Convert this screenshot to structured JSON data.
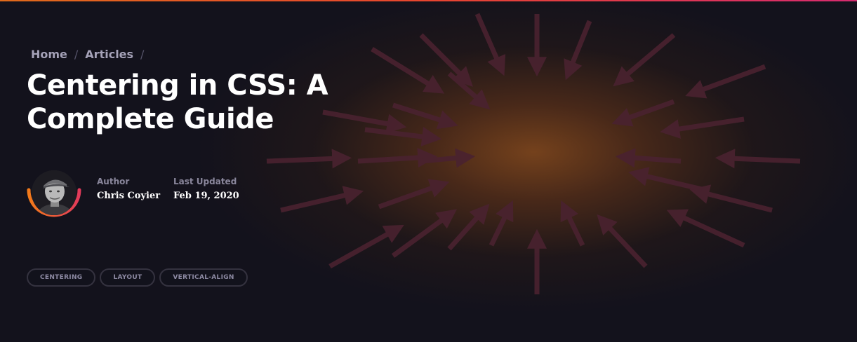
{
  "breadcrumb": {
    "items": [
      "Home",
      "Articles"
    ],
    "separator": "/"
  },
  "article": {
    "title": "Centering in CSS: A Complete Guide"
  },
  "meta": {
    "author_label": "Author",
    "author_name": "Chris Coyier",
    "updated_label": "Last Updated",
    "updated_date": "Feb 19, 2020"
  },
  "tags": [
    "CENTERING",
    "LAYOUT",
    "VERTICAL-ALIGN"
  ],
  "colors": {
    "background": "#13121c",
    "glow": "#7a441c",
    "arrow": "#4a2230",
    "accent_start": "#e06a1b",
    "accent_end": "#d62b6f"
  }
}
